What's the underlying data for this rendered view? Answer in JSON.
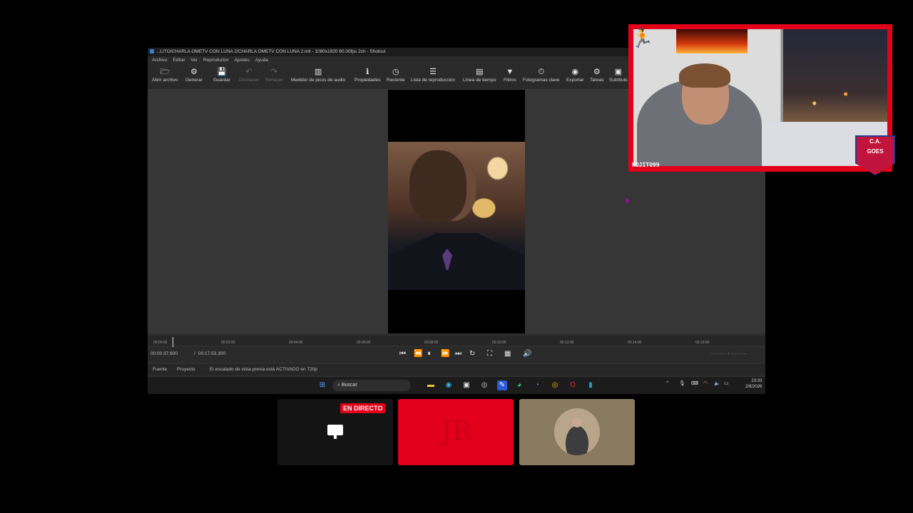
{
  "window": {
    "title": "...LITO/CHARLA OMETV CON LUNA 2/CHARLA OMETV CON LUNA 2.mlt - 1080x1920 60.00fps 2ch - Shotcut",
    "menu": [
      "Archivo",
      "Editar",
      "Ver",
      "Reproductor",
      "Ajustes",
      "Ayuda"
    ]
  },
  "toolbar": [
    {
      "label": "Abrir archivo",
      "icon": "folder-open-icon",
      "glyph": "🗁"
    },
    {
      "label": "Generar",
      "icon": "generate-icon",
      "glyph": "⚙"
    },
    {
      "label": "Guardar",
      "icon": "save-icon",
      "glyph": "💾"
    },
    {
      "label": "Deshacer",
      "icon": "undo-icon",
      "glyph": "↶",
      "disabled": true
    },
    {
      "label": "Rehacer",
      "icon": "redo-icon",
      "glyph": "↷",
      "disabled": true
    },
    {
      "label": "Medidor de picos de audio",
      "icon": "audio-meter-icon",
      "glyph": "▥"
    },
    {
      "label": "Propiedades",
      "icon": "info-icon",
      "glyph": "ℹ"
    },
    {
      "label": "Reciente",
      "icon": "clock-icon",
      "glyph": "◷"
    },
    {
      "label": "Lista de reproducción",
      "icon": "playlist-icon",
      "glyph": "☰"
    },
    {
      "label": "Línea de tiempo",
      "icon": "timeline-icon",
      "glyph": "▤"
    },
    {
      "label": "Filtros",
      "icon": "filter-icon",
      "glyph": "▼"
    },
    {
      "label": "Fotogramas clave",
      "icon": "keyframes-icon",
      "glyph": "⏱"
    },
    {
      "label": "Exportar",
      "icon": "export-icon",
      "glyph": "◉"
    },
    {
      "label": "Tareas",
      "icon": "gear-icon",
      "glyph": "⚙"
    },
    {
      "label": "Subtítulo",
      "icon": "subtitle-icon",
      "glyph": "▣"
    }
  ],
  "ruler": [
    "00:00:00",
    "00:02:00",
    "00:04:00",
    "00:06:00",
    "00:08:00",
    "00:10:00",
    "00:12:00",
    "00:14:00",
    "00:16:00"
  ],
  "transport": {
    "current": "00:00:37.600",
    "separator": "/",
    "duration": "00:17:53.300",
    "in_out": "--:--:--:-- / --:--:--:--"
  },
  "tabs": {
    "source": "Fuente",
    "project": "Proyecto",
    "status": "El escalado de vista previa está ACTIVADO en 720p"
  },
  "taskbar": {
    "search": "Buscar",
    "time": "23:33",
    "date": "2/8/2026"
  },
  "webcam": {
    "name": "ROJITO99",
    "badge_top": "C.A.",
    "badge_bottom": "GOES"
  },
  "stream": {
    "live_label": "EN DIRECTO",
    "logo_text": "JR"
  },
  "colors": {
    "accent": "#e3001b",
    "shotcut_bg": "#2f2f2f"
  }
}
